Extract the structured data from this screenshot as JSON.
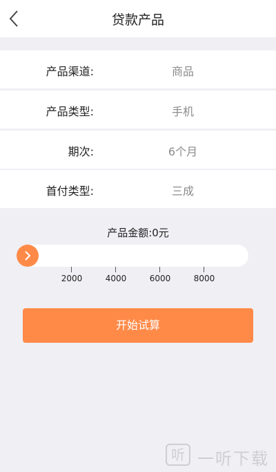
{
  "header": {
    "title": "贷款产品"
  },
  "form": {
    "rows": [
      {
        "label": "产品渠道:",
        "value": "商品"
      },
      {
        "label": "产品类型:",
        "value": "手机"
      },
      {
        "label": "期次:",
        "value": "6个月"
      },
      {
        "label": "首付类型:",
        "value": "三成"
      }
    ]
  },
  "slider": {
    "amount_label": "产品金额:0元",
    "value": 0,
    "ticks": [
      "2000",
      "4000",
      "6000",
      "8000"
    ]
  },
  "actions": {
    "start_label": "开始试算"
  },
  "watermark": {
    "icon_text": "听",
    "text": "一听下载"
  },
  "colors": {
    "accent": "#ff8a48",
    "background": "#efeff4"
  }
}
